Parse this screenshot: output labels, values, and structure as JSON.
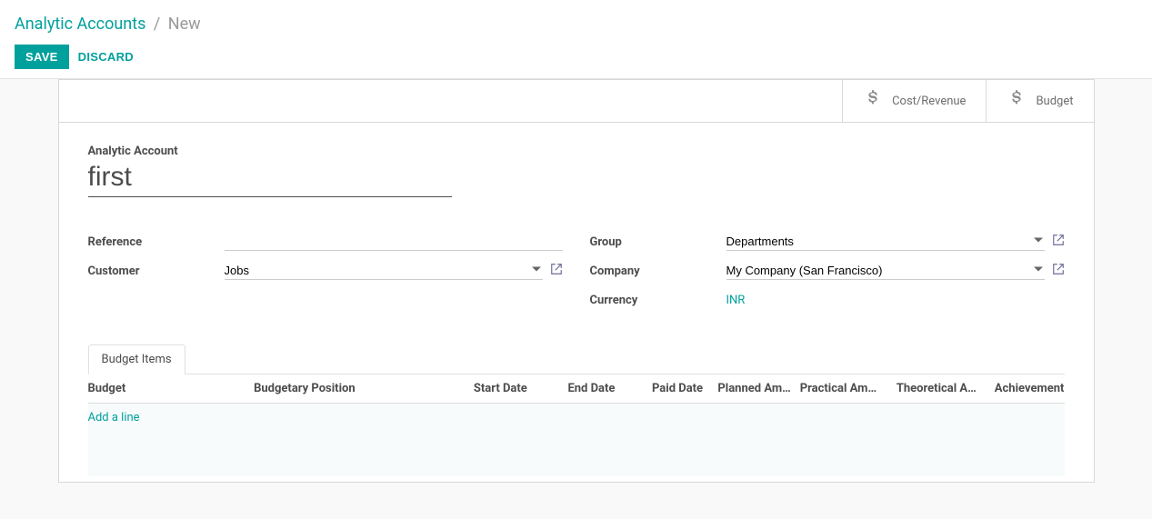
{
  "breadcrumb": {
    "parent": "Analytic Accounts",
    "current": "New"
  },
  "actions": {
    "save": "SAVE",
    "discard": "DISCARD"
  },
  "stat_buttons": {
    "cost_revenue": "Cost/Revenue",
    "budget": "Budget"
  },
  "form": {
    "title_label": "Analytic Account",
    "title_value": "first",
    "reference": {
      "label": "Reference",
      "value": ""
    },
    "customer": {
      "label": "Customer",
      "value": "Jobs"
    },
    "group": {
      "label": "Group",
      "value": "Departments"
    },
    "company": {
      "label": "Company",
      "value": "My Company (San Francisco)"
    },
    "currency": {
      "label": "Currency",
      "value": "INR"
    }
  },
  "tabs": {
    "budget_items": "Budget Items"
  },
  "table": {
    "headers": {
      "budget": "Budget",
      "budgetary_position": "Budgetary Position",
      "start_date": "Start Date",
      "end_date": "End Date",
      "paid_date": "Paid Date",
      "planned_amount": "Planned Am…",
      "practical_amount": "Practical Amo…",
      "theoretical_amount": "Theoretical A…",
      "achievement": "Achievement"
    },
    "add_line": "Add a line"
  }
}
